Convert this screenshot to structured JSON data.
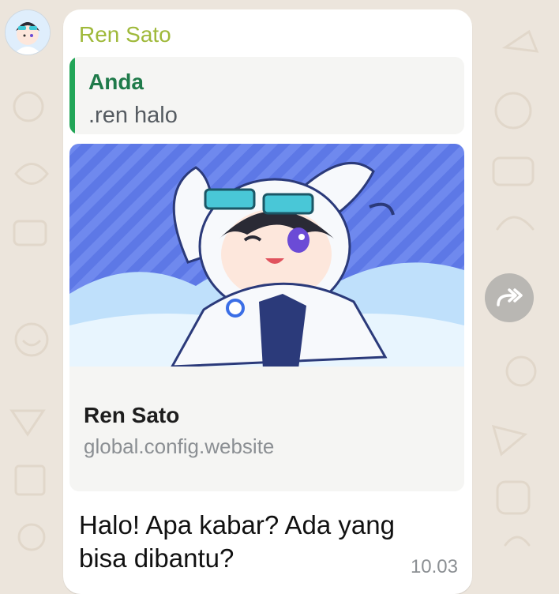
{
  "chat": {
    "sender_name": "Ren Sato",
    "quoted": {
      "author": "Anda",
      "text": ".ren halo"
    },
    "link_preview": {
      "title": "Ren Sato",
      "domain": "global.config.website"
    },
    "message_text": "Halo! Apa kabar? Ada yang bisa dibantu?",
    "timestamp": "10.03"
  },
  "icons": {
    "forward": "forward-icon",
    "avatar": "avatar"
  },
  "colors": {
    "sender_name": "#9fb93a",
    "quote_bar": "#22a557",
    "quote_author": "#1f7a4a",
    "bubble": "#ffffff",
    "background": "#ece5dc"
  }
}
